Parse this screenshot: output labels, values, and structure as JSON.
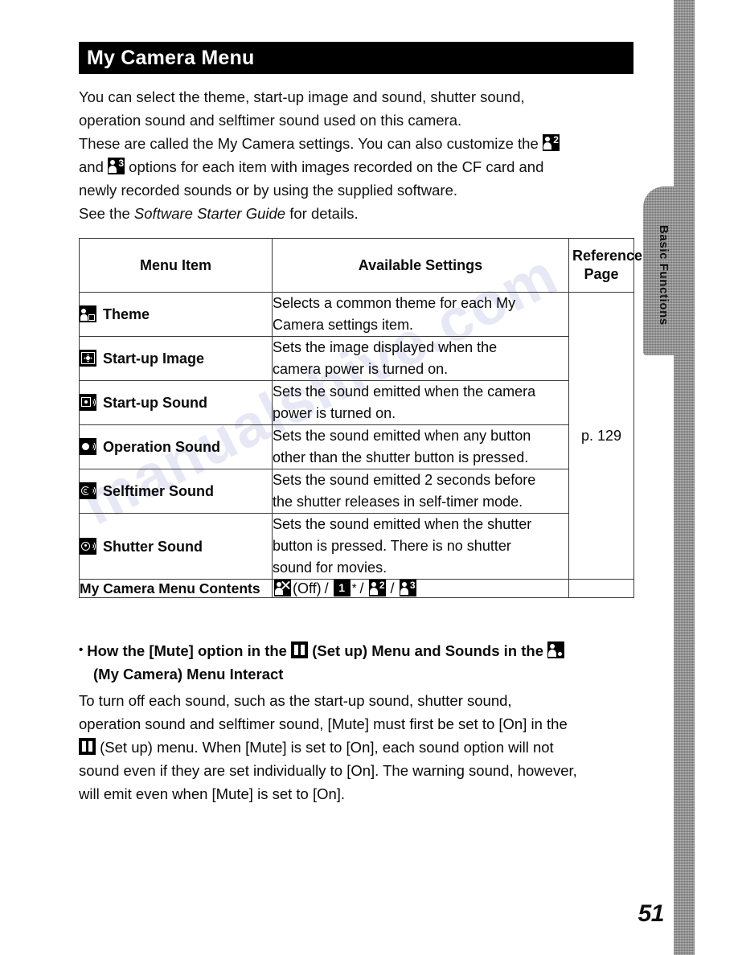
{
  "page": {
    "number": "51",
    "side_tab_label": "Basic Functions",
    "watermark": "manualshive.com"
  },
  "header": {
    "title": "My Camera Menu"
  },
  "intro": {
    "lines": [
      "You can select the theme, start-up image and sound, shutter sound,",
      "operation sound and selftimer sound used on this camera."
    ],
    "line3_a": "These are called the My Camera settings. You can also customize the ",
    "line4_a": "and ",
    "line4_b": " options for each item with images recorded on the CF card and",
    "line5": "newly recorded sounds or by using the supplied software.",
    "line6_a": "See the ",
    "line6_italic": "Software Starter Guide",
    "line6_b": " for details.",
    "icon_my_camera_2": "my-camera-2-icon",
    "icon_my_camera_3": "my-camera-3-icon"
  },
  "table": {
    "headers": {
      "menu_item": "Menu Item",
      "available_settings": "Available Settings",
      "reference_page": "Reference\nPage",
      "reference_page_line1": "Reference",
      "reference_page_line2": "Page"
    },
    "reference_page_value": "p. 129",
    "rows": [
      {
        "icon": "theme-icon",
        "label": "Theme",
        "desc_lines": [
          "Selects a common theme for each My",
          "Camera settings item."
        ]
      },
      {
        "icon": "startup-image-icon",
        "label": "Start-up Image",
        "desc_lines": [
          "Sets the image displayed when the",
          "camera power is turned on."
        ]
      },
      {
        "icon": "startup-sound-icon",
        "label": "Start-up Sound",
        "desc_lines": [
          "Sets the sound emitted when the camera",
          "power is turned on."
        ]
      },
      {
        "icon": "operation-sound-icon",
        "label": "Operation Sound",
        "desc_lines": [
          "Sets the sound emitted when any button",
          "other than the shutter button is pressed."
        ]
      },
      {
        "icon": "selftimer-sound-icon",
        "label": "Selftimer Sound",
        "desc_lines": [
          "Sets the sound emitted 2 seconds before",
          "the shutter releases in self-timer mode."
        ]
      },
      {
        "icon": "shutter-sound-icon",
        "label": "Shutter Sound",
        "desc_lines": [
          "Sets the sound emitted when the shutter",
          "button is pressed. There is no shutter",
          "sound for movies."
        ]
      }
    ],
    "contents_row": {
      "label": "My Camera Menu Contents",
      "off_label": "(Off)",
      "sep": "/",
      "star": "*",
      "option_off_icon": "my-camera-off-icon",
      "option_1_icon": "my-camera-1-icon",
      "option_1_text": "1",
      "option_2_icon": "my-camera-2-icon",
      "option_2_text": "2",
      "option_3_icon": "my-camera-3-icon",
      "option_3_text": "3"
    }
  },
  "note": {
    "bullet": "•",
    "head_a": "How the [Mute] option in the ",
    "head_b": " (Set up) Menu and Sounds in the ",
    "head_line2": "(My Camera) Menu Interact",
    "icon_setup": "set-up-icon",
    "icon_my_camera": "my-camera-icon",
    "body_lines": [
      "To turn off each sound, such as the start-up sound, shutter sound,",
      "operation sound and selftimer sound, [Mute] must first be set to [On] in the"
    ],
    "body_line3_a": " (Set up) menu. When [Mute] is set to [On], each sound option will not",
    "body_lines_tail": [
      "sound even if they are set individually to [On]. The warning sound, however,",
      "will emit even when [Mute] is set to [On]."
    ]
  }
}
